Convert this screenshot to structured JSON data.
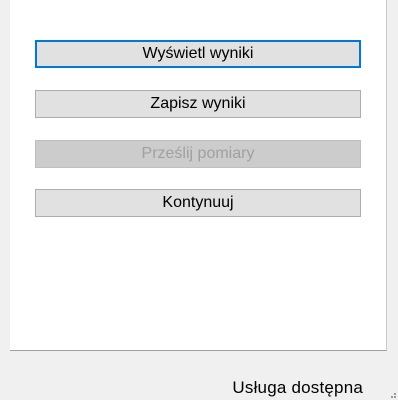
{
  "buttons": {
    "show_results": "Wyświetl wyniki",
    "save_results": "Zapisz wyniki",
    "send_report": "Prześlij pomiary",
    "continue": "Kontynuuj"
  },
  "status": {
    "text": "Usługa dostępna"
  },
  "colors": {
    "accent": "#0078d7",
    "button_bg": "#e1e1e1",
    "disabled_bg": "#cccccc",
    "disabled_text": "#a0a0a0"
  }
}
